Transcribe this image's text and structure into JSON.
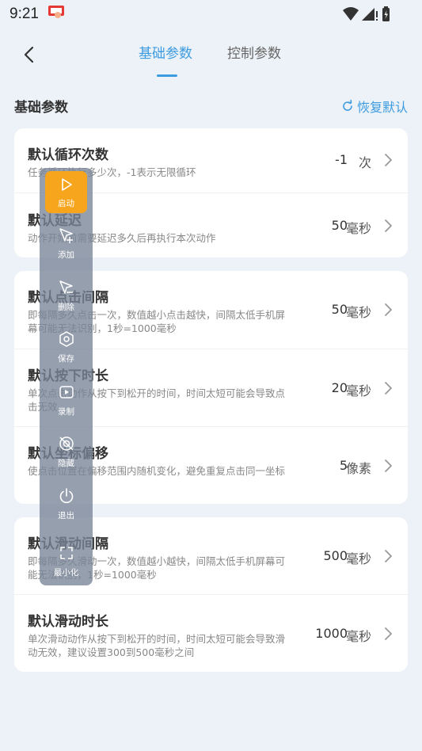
{
  "status": {
    "time": "9:21"
  },
  "tabs": [
    {
      "label": "基础参数",
      "active": true
    },
    {
      "label": "控制参数",
      "active": false
    }
  ],
  "section": {
    "title": "基础参数",
    "restore_label": "恢复默认"
  },
  "cards": [
    {
      "rows": [
        {
          "title": "默认循环次数",
          "desc": "任务循环执行多少次，-1表示无限循环",
          "value": "-1",
          "unit": "次"
        },
        {
          "title": "默认延迟",
          "desc": "动作开始前需要延迟多久后再执行本次动作",
          "value": "50",
          "unit": "毫秒"
        }
      ]
    },
    {
      "rows": [
        {
          "title": "默认点击间隔",
          "desc": "即每隔多久点击一次，数值越小点击越快，间隔太低手机屏幕可能无法识别，1秒=1000毫秒",
          "value": "50",
          "unit": "毫秒"
        },
        {
          "title": "默认按下时长",
          "desc": "单次点击动作从按下到松开的时间，时间太短可能会导致点击无效",
          "value": "20",
          "unit": "毫秒"
        },
        {
          "title": "默认坐标偏移",
          "desc": "使点击位置在偏移范围内随机变化，避免重复点击同一坐标",
          "value": "5",
          "unit": "像素"
        }
      ]
    },
    {
      "rows": [
        {
          "title": "默认滑动间隔",
          "desc": "即每隔多久滑动一次，数值越小越快，间隔太低手机屏幕可能无法识别，1秒=1000毫秒",
          "value": "500",
          "unit": "毫秒"
        },
        {
          "title": "默认滑动时长",
          "desc": "单次滑动动作从按下到松开的时间，时间太短可能会导致滑动无效，建议设置300到500毫秒之间",
          "value": "1000",
          "unit": "毫秒"
        }
      ]
    }
  ],
  "float_panel": {
    "items": [
      {
        "label": "启动",
        "icon": "play-icon"
      },
      {
        "label": "添加",
        "icon": "add-pointer-icon"
      },
      {
        "label": "删除",
        "icon": "remove-pointer-icon"
      },
      {
        "label": "保存",
        "icon": "save-icon"
      },
      {
        "label": "录制",
        "icon": "record-icon"
      },
      {
        "label": "隐藏",
        "icon": "hide-icon"
      },
      {
        "label": "退出",
        "icon": "power-icon"
      },
      {
        "label": "最小化",
        "icon": "minimize-icon"
      }
    ]
  },
  "colors": {
    "accent": "#3d9be0",
    "start": "#f7a51c",
    "background": "#edf2f8"
  }
}
